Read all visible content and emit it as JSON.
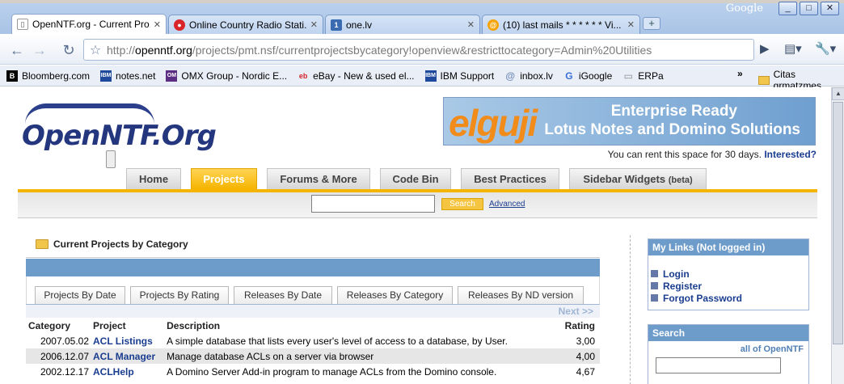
{
  "browser": {
    "google_label": "Google",
    "window_controls": [
      "_",
      "□",
      "✕"
    ],
    "tabs": [
      {
        "title": "OpenNTF.org - Current Pro...",
        "icon": "page-icon",
        "active": true
      },
      {
        "title": "Online Country Radio Stati...",
        "icon": "radio-icon",
        "active": false
      },
      {
        "title": "one.lv",
        "icon": "one-lv-icon",
        "active": false
      },
      {
        "title": "(10) last mails * * * * * * Vi...",
        "icon": "mail-icon",
        "active": false
      }
    ],
    "new_tab": "+",
    "url_host": "openntf.org",
    "url_prefix": "http://",
    "url_path": "/projects/pmt.nsf/currentprojectsbycategory!openview&restricttocategory=Admin%20Utilities",
    "bookmarks": [
      {
        "label": "Bloomberg.com",
        "icon": "B",
        "color": "#000000"
      },
      {
        "label": "notes.net",
        "icon": "IBM",
        "color": "#1f4a9c"
      },
      {
        "label": "OMX Group - Nordic E...",
        "icon": "OM",
        "color": "#5b2d83"
      },
      {
        "label": "eBay - New & used el...",
        "icon": "eb",
        "color": "#d4242a"
      },
      {
        "label": "IBM Support",
        "icon": "IBM",
        "color": "#1f4a9c"
      },
      {
        "label": "inbox.lv",
        "icon": "@",
        "color": "#6e8cb8"
      },
      {
        "label": "iGoogle",
        "icon": "G",
        "color": "#3a6fd8"
      },
      {
        "label": "ERPa",
        "icon": "▭",
        "color": "#8a8a8a"
      }
    ],
    "bookmarks_more": "»",
    "other_bookmarks": "Citas grmatzmes"
  },
  "site": {
    "logo_text": "OpenNTF.Org",
    "banner": {
      "brand": "elguji",
      "line1": "Enterprise Ready",
      "line2": "Lotus Notes and Domino Solutions"
    },
    "rent_text": "You can rent this space for 30 days. ",
    "rent_link": "Interested?",
    "nav": [
      {
        "label": "Home",
        "active": false
      },
      {
        "label": "Projects",
        "active": true
      },
      {
        "label": "Forums & More",
        "active": false
      },
      {
        "label": "Code Bin",
        "active": false
      },
      {
        "label": "Best Practices",
        "active": false
      },
      {
        "label": "Sidebar Widgets",
        "suffix": "(beta)",
        "active": false
      }
    ],
    "search_button": "Search",
    "advanced_link": "Advanced"
  },
  "main": {
    "title": "Current Projects by Category",
    "view_tabs": [
      "Projects By Date",
      "Projects By Rating",
      "Releases By Date",
      "Releases By Category",
      "Releases By ND version"
    ],
    "next": "Next >>",
    "columns": [
      "Category",
      "Project",
      "Description",
      "Rating"
    ],
    "rows": [
      {
        "date": "2007.05.02",
        "project": "ACL Listings",
        "description": "A simple database that lists every user's level of access to a database, by User.",
        "rating": "3,00"
      },
      {
        "date": "2006.12.07",
        "project": "ACL Manager",
        "description": "Manage database ACLs on a server via browser",
        "rating": "4,00"
      },
      {
        "date": "2002.12.17",
        "project": "ACLHelp",
        "description": "A Domino Server Add-in program to manage ACLs from the Domino console.",
        "rating": "4,67"
      }
    ]
  },
  "sidebar": {
    "links_title": "My Links (Not logged in)",
    "links": [
      "Login",
      "Register",
      "Forgot Password"
    ],
    "search_title": "Search",
    "search_scope": "all of OpenNTF"
  }
}
